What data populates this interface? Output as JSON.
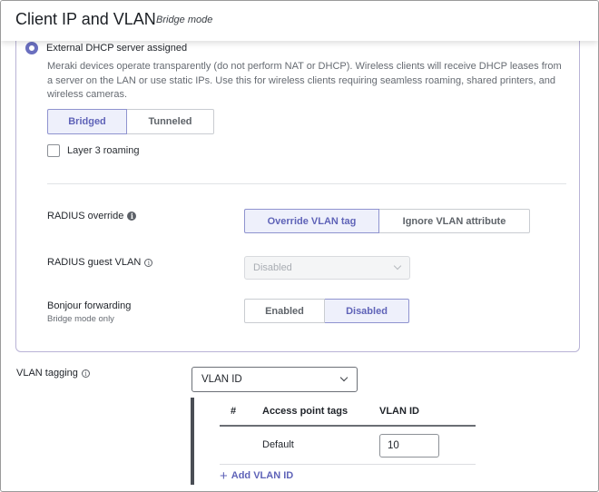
{
  "header": {
    "title": "Client IP and VLAN",
    "subtitle": "Bridge mode"
  },
  "dhcp_option": {
    "label": "External DHCP server assigned",
    "selected": true,
    "description": "Meraki devices operate transparently (do not perform NAT or DHCP). Wireless clients will receive DHCP leases from a server on the LAN or use static IPs. Use this for wireless clients requiring seamless roaming, shared printers, and wireless cameras."
  },
  "mode_toggle": {
    "options": [
      "Bridged",
      "Tunneled"
    ],
    "selected": "Bridged"
  },
  "layer3_roaming": {
    "label": "Layer 3 roaming",
    "checked": false
  },
  "radius_override": {
    "label": "RADIUS override",
    "info_icon": "info-circle-filled",
    "options": [
      "Override VLAN tag",
      "Ignore VLAN attribute"
    ],
    "selected": "Override VLAN tag"
  },
  "radius_guest_vlan": {
    "label": "RADIUS guest VLAN",
    "info_icon": "info-circle-outline",
    "value": "Disabled",
    "disabled": true
  },
  "bonjour_forwarding": {
    "label": "Bonjour forwarding",
    "hint": "Bridge mode only",
    "options": [
      "Enabled",
      "Disabled"
    ],
    "selected": "Disabled"
  },
  "vlan_tagging": {
    "label": "VLAN tagging",
    "info_icon": "info-circle-outline",
    "value": "VLAN ID",
    "table": {
      "columns": [
        "#",
        "Access point tags",
        "VLAN ID"
      ],
      "rows": [
        {
          "number": "",
          "tags": "Default",
          "vlan_id": "10"
        }
      ]
    },
    "add_label": "Add VLAN ID"
  },
  "colors": {
    "accent": "#5f63b8",
    "active_bg": "#eef0fb",
    "panel_border": "#b9b3d6"
  }
}
